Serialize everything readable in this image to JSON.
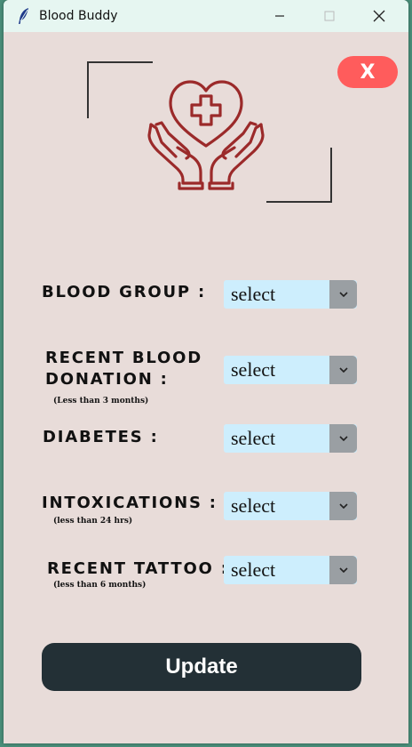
{
  "window": {
    "title": "Blood Buddy",
    "minimize_icon": "minimize-icon",
    "maximize_icon": "maximize-icon",
    "close_icon": "close-icon"
  },
  "close_button": {
    "label": "X",
    "color": "#ff5c5c"
  },
  "logo": {
    "icon": "heart-cross-hands-icon",
    "color": "#9b2a2a"
  },
  "form": {
    "blood_group": {
      "label": "BLOOD GROUP :",
      "value": "select"
    },
    "recent_donation": {
      "label_line1": "RECENT BLOOD",
      "label_line2": "DONATION :",
      "hint": "(Less than 3 months)",
      "value": "select"
    },
    "diabetes": {
      "label": "DIABETES :",
      "value": "select"
    },
    "intoxications": {
      "label": "INTOXICATIONS :",
      "hint": "(less than 24 hrs)",
      "value": "select"
    },
    "recent_tattoo": {
      "label": "RECENT TATTOO :",
      "hint": "(less than 6 months)",
      "value": "select"
    }
  },
  "update_button": {
    "label": "Update",
    "color": "#233036"
  },
  "colors": {
    "background": "#e8dcd9",
    "select_bg": "#cdeefd",
    "select_arrow_bg": "#9a9fa3",
    "titlebar": "#e6f6f1"
  }
}
